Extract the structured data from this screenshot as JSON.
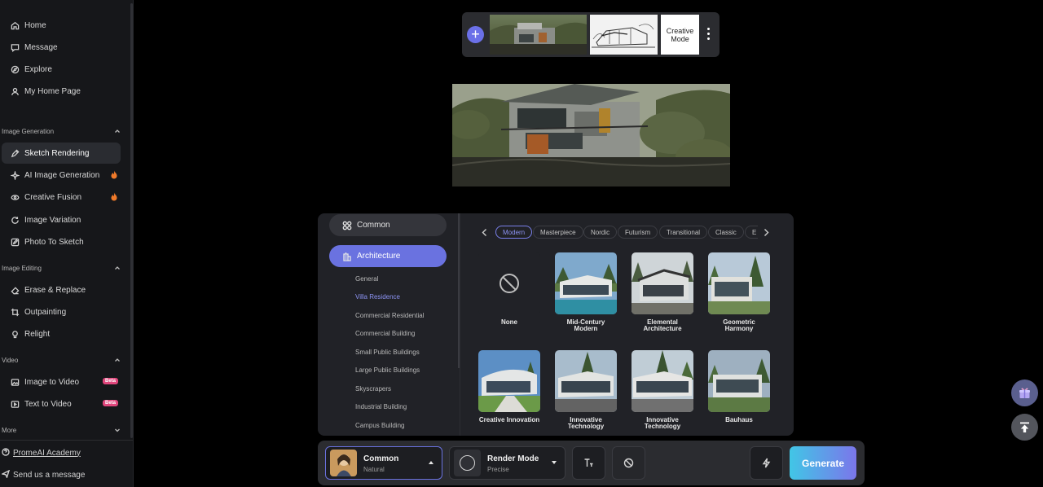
{
  "sidebar": {
    "top_items": [
      {
        "label": "Home",
        "icon": "home-icon"
      },
      {
        "label": "Message",
        "icon": "message-icon"
      },
      {
        "label": "Explore",
        "icon": "explore-icon"
      },
      {
        "label": "My Home Page",
        "icon": "user-icon"
      }
    ],
    "sections": [
      {
        "title": "Image Generation",
        "items": [
          {
            "label": "Sketch Rendering",
            "active": true
          },
          {
            "label": "AI Image Generation",
            "hot": true
          },
          {
            "label": "Creative Fusion",
            "hot": true
          },
          {
            "label": "Image Variation"
          },
          {
            "label": "Photo To Sketch"
          }
        ]
      },
      {
        "title": "Image Editing",
        "items": [
          {
            "label": "Erase & Replace"
          },
          {
            "label": "Outpainting"
          },
          {
            "label": "Relight"
          }
        ]
      },
      {
        "title": "Video",
        "items": [
          {
            "label": "Image to Video",
            "badge": "Beta"
          },
          {
            "label": "Text to Video",
            "badge": "Beta"
          }
        ]
      },
      {
        "title": "More",
        "items": []
      }
    ],
    "academy_link": "PromeAI Academy",
    "message_link": "Send us a message"
  },
  "topstrip": {
    "add_label": "+",
    "mode_label": "Creative Mode"
  },
  "panel": {
    "categories": [
      "Common",
      "Architecture"
    ],
    "subcategories": [
      "General",
      "Villa Residence",
      "Commercial Residential",
      "Commercial Building",
      "Small Public Buildings",
      "Large Public Buildings",
      "Skyscrapers",
      "Industrial Building",
      "Campus Building"
    ],
    "active_subcategory": "Villa Residence",
    "tabs": [
      "Modern",
      "Masterpiece",
      "Nordic",
      "Futurism",
      "Transitional",
      "Classic",
      "E"
    ],
    "active_tab": "Modern",
    "styles": [
      {
        "label": "None"
      },
      {
        "label": "Mid-Century Modern"
      },
      {
        "label": "Elemental Architecture"
      },
      {
        "label": "Geometric Harmony"
      },
      {
        "label": "Creative Innovation"
      },
      {
        "label": "Innovative Technology"
      },
      {
        "label": "Innovative Technology"
      },
      {
        "label": "Bauhaus"
      }
    ]
  },
  "toolbar": {
    "style_title": "Common",
    "style_sub": "Natural",
    "render_title": "Render Mode",
    "render_sub": "Precise",
    "generate_label": "Generate"
  },
  "colors": {
    "accent": "#6a72e0",
    "hot": "#f07a2a",
    "beta": "#e0467c"
  }
}
